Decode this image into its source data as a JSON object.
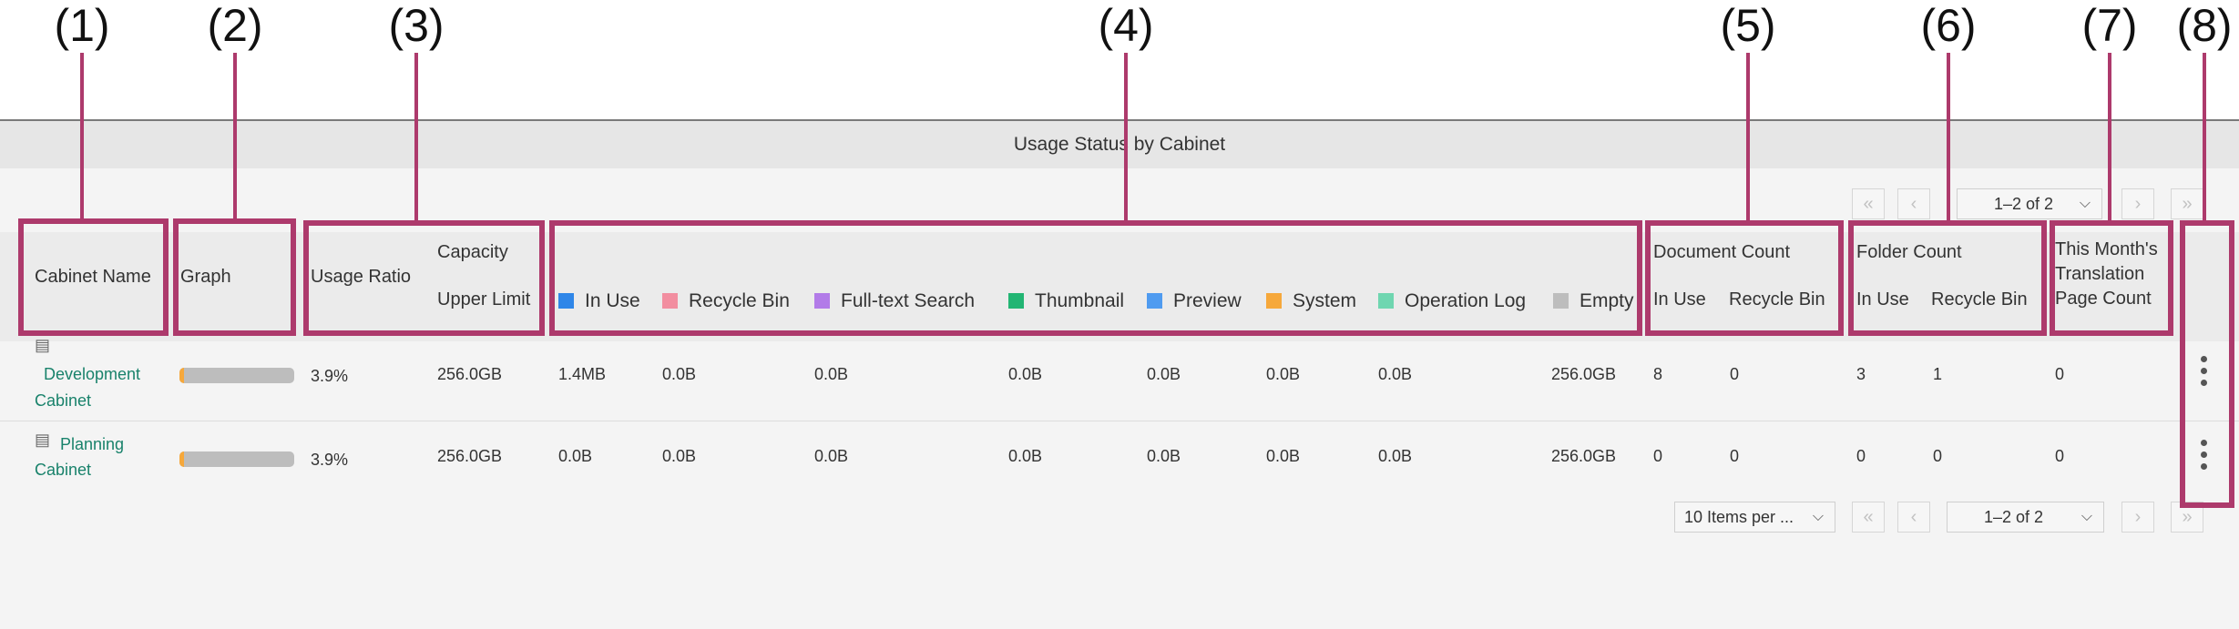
{
  "callouts": [
    "(1)",
    "(2)",
    "(3)",
    "(4)",
    "(5)",
    "(6)",
    "(7)",
    "(8)"
  ],
  "panel": {
    "title": "Usage Status by Cabinet"
  },
  "pager_top": {
    "first": "«",
    "prev": "‹",
    "range": "1–2 of 2",
    "next": "›",
    "last": "»"
  },
  "pager_bottom": {
    "per_page": "10 Items per ...",
    "first": "«",
    "prev": "‹",
    "range": "1–2 of 2",
    "next": "›",
    "last": "»"
  },
  "headers": {
    "cabinet_name": "Cabinet Name",
    "graph": "Graph",
    "usage_ratio": "Usage Ratio",
    "capacity": "Capacity",
    "upper_limit": "Upper Limit",
    "document_count": "Document Count",
    "doc_in_use": "In Use",
    "doc_recycle": "Recycle Bin",
    "folder_count": "Folder Count",
    "folder_in_use": "In Use",
    "folder_recycle": "Recycle Bin",
    "translation_1": "This Month's",
    "translation_2": "Translation",
    "translation_3": "Page Count"
  },
  "legend": [
    {
      "label": "In Use",
      "color": "#2f86e8"
    },
    {
      "label": "Recycle Bin",
      "color": "#f28ea0"
    },
    {
      "label": "Full-text Search",
      "color": "#b27be8"
    },
    {
      "label": "Thumbnail",
      "color": "#22b573"
    },
    {
      "label": "Preview",
      "color": "#4f9bf0"
    },
    {
      "label": "System",
      "color": "#f6a83b"
    },
    {
      "label": "Operation Log",
      "color": "#6fd6b0"
    },
    {
      "label": "Empty",
      "color": "#bdbdbd"
    }
  ],
  "rows": [
    {
      "name_line1": "Development",
      "name_line2": "Cabinet",
      "usage_percent": 3.9,
      "usage_ratio": "3.9%",
      "upper_limit": "256.0GB",
      "in_use": "1.4MB",
      "recycle_bin": "0.0B",
      "full_text": "0.0B",
      "thumbnail": "0.0B",
      "preview": "0.0B",
      "system": "0.0B",
      "operation_log": "0.0B",
      "empty": "256.0GB",
      "doc_in_use": "8",
      "doc_recycle": "0",
      "folder_in_use": "3",
      "folder_recycle": "1",
      "translation": "0"
    },
    {
      "name_line1": "Planning",
      "name_line2": "Cabinet",
      "usage_percent": 3.9,
      "usage_ratio": "3.9%",
      "upper_limit": "256.0GB",
      "in_use": "0.0B",
      "recycle_bin": "0.0B",
      "full_text": "0.0B",
      "thumbnail": "0.0B",
      "preview": "0.0B",
      "system": "0.0B",
      "operation_log": "0.0B",
      "empty": "256.0GB",
      "doc_in_use": "0",
      "doc_recycle": "0",
      "folder_in_use": "0",
      "folder_recycle": "0",
      "translation": "0"
    }
  ],
  "icons": {
    "cabinet": "cabinet-icon",
    "more": "more-vertical-icon",
    "first": "first-page-icon",
    "prev": "previous-page-icon",
    "next": "next-page-icon",
    "last": "last-page-icon",
    "dropdown": "chevron-down-icon"
  }
}
